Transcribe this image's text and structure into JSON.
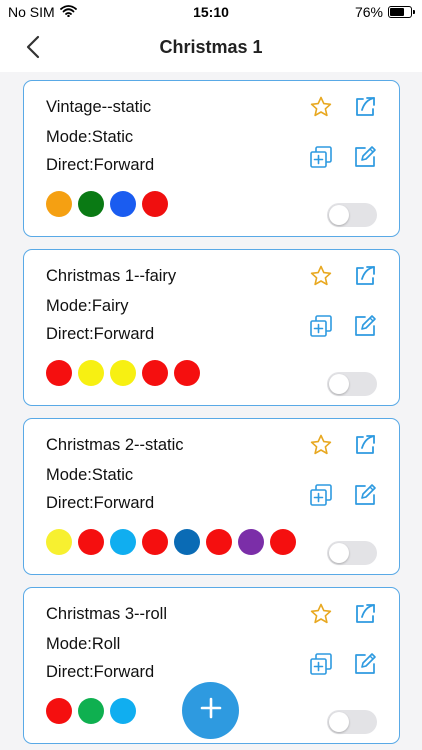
{
  "status_bar": {
    "carrier": "No SIM",
    "time": "15:10",
    "battery": "76%",
    "battery_level": 0.76
  },
  "nav": {
    "title": "Christmas 1",
    "back_icon": "chevron-left-icon"
  },
  "icons": {
    "favorite": "star-icon",
    "share": "share-icon",
    "copy": "copy-icon",
    "edit": "edit-icon",
    "add": "plus-icon",
    "wifi": "wifi-icon",
    "battery": "battery-icon"
  },
  "accent_color": "#2e9ae0",
  "star_color": "#e8a820",
  "cards": [
    {
      "name": "Vintage--static",
      "mode": "Mode:Static",
      "direct": "Direct:Forward",
      "colors": [
        "#f5a012",
        "#0a7a14",
        "#1a5cf0",
        "#f00f0f"
      ],
      "enabled": false
    },
    {
      "name": "Christmas 1--fairy",
      "mode": "Mode:Fairy",
      "direct": "Direct:Forward",
      "colors": [
        "#f50f0f",
        "#f7f012",
        "#f7f012",
        "#f50f0f",
        "#f50f0f"
      ],
      "enabled": false
    },
    {
      "name": "Christmas 2--static",
      "mode": "Mode:Static",
      "direct": "Direct:Forward",
      "colors": [
        "#f7f030",
        "#f50f0f",
        "#10aef0",
        "#f50f0f",
        "#0a6bb5",
        "#f50f0f",
        "#7b2ea8",
        "#f50f0f"
      ],
      "enabled": false
    },
    {
      "name": "Christmas 3--roll",
      "mode": "Mode:Roll",
      "direct": "Direct:Forward",
      "colors": [
        "#f50f0f",
        "#0fb050",
        "#10aef0"
      ],
      "enabled": false
    }
  ]
}
